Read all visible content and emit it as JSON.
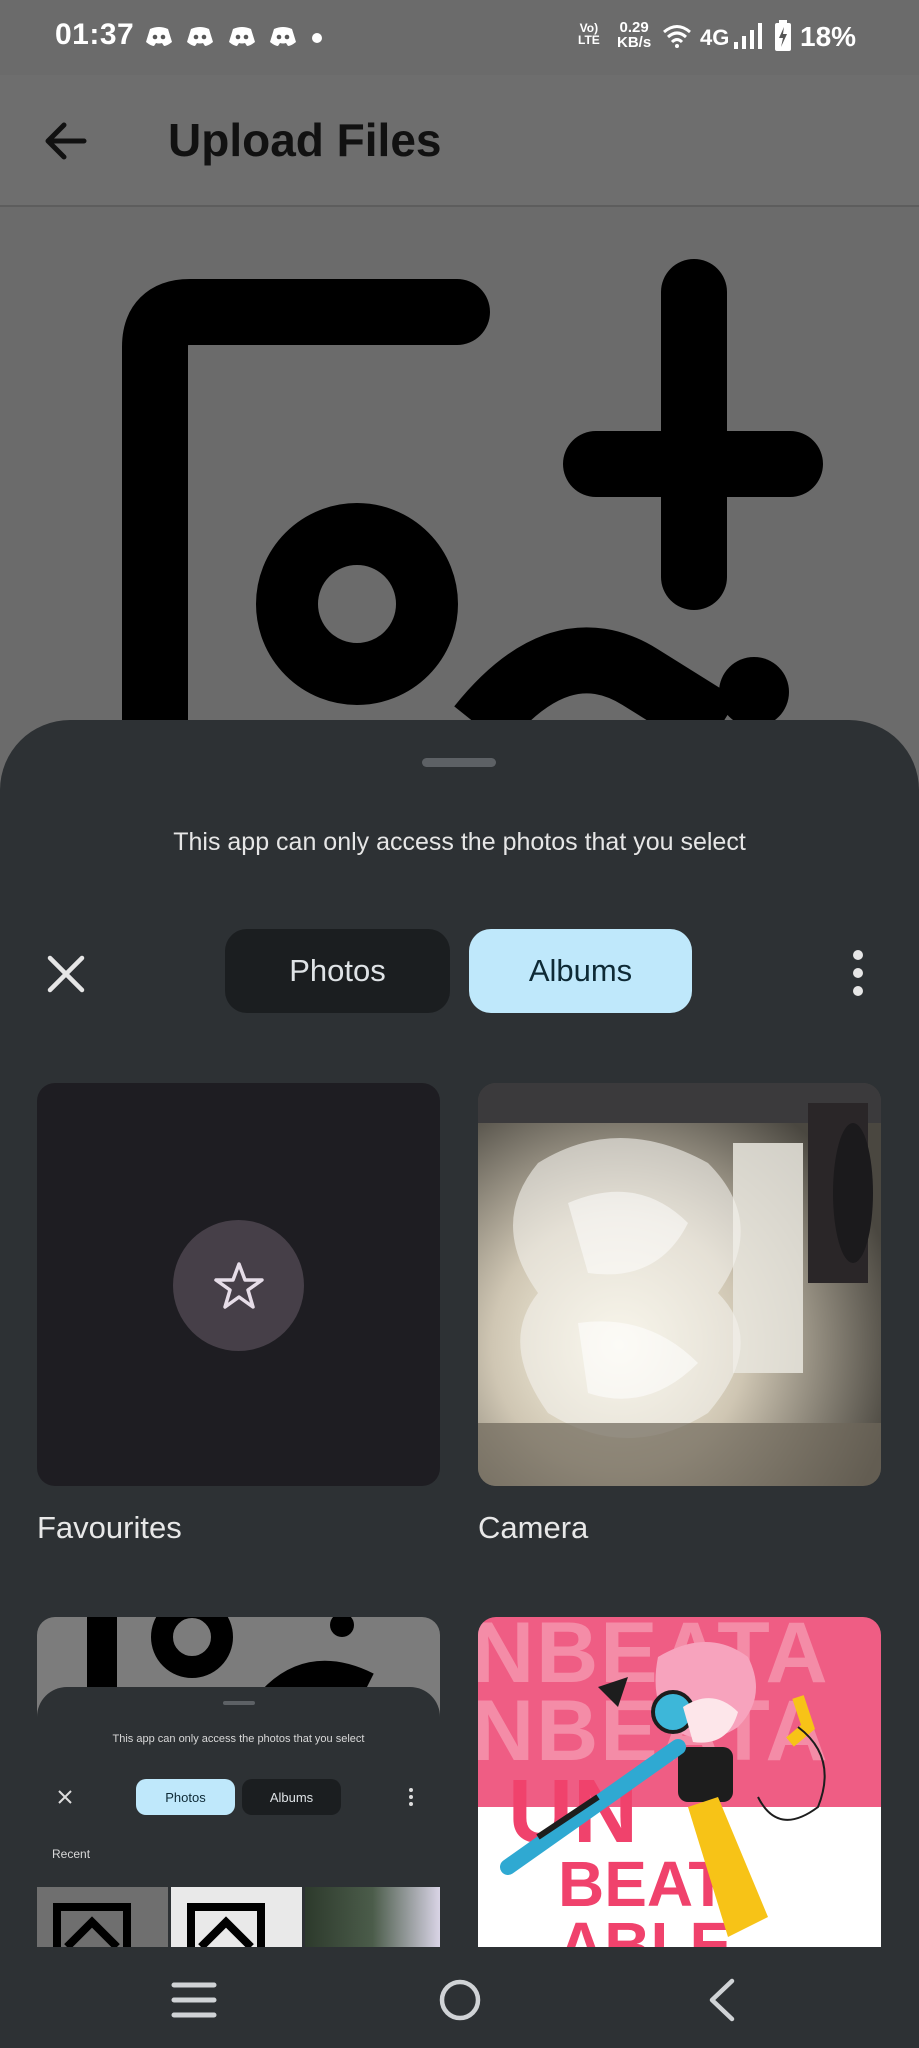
{
  "status_bar": {
    "time": "01:37",
    "volte_line1": "Vo)",
    "volte_line2": "LTE",
    "speed_value": "0.29",
    "speed_unit": "KB/s",
    "network": "4G",
    "battery": "18%"
  },
  "header": {
    "title": "Upload Files"
  },
  "picker": {
    "note": "This app can only access the photos that you select",
    "tabs": [
      {
        "label": "Photos",
        "selected": false
      },
      {
        "label": "Albums",
        "selected": true
      }
    ],
    "albums": [
      {
        "label": "Favourites",
        "icon": "star-icon"
      },
      {
        "label": "Camera"
      }
    ]
  },
  "mini_preview": {
    "note": "This app can only access the photos that you select",
    "tab_photos": "Photos",
    "tab_albums": "Albums",
    "recent": "Recent"
  },
  "poster_text": {
    "line1": "NBEATA",
    "line2": "NBEATA",
    "line3": "UN",
    "line4": "BEAT",
    "line5": "ABLE"
  },
  "colors": {
    "sheet_bg": "#2d3134",
    "selected_tab": "#bfe8fb",
    "unselected_tab": "#1b1e20",
    "poster_pink": "#ef5d84"
  }
}
